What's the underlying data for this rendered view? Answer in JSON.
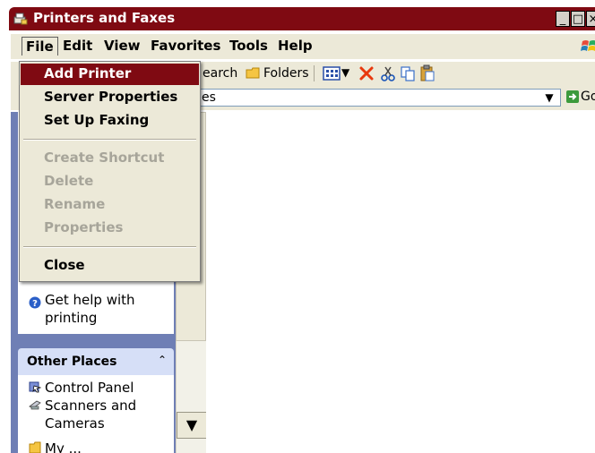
{
  "window": {
    "title": "Printers and Faxes"
  },
  "title_buttons": {
    "minimize": "_",
    "maximize": "□",
    "close": "×"
  },
  "menubar": {
    "items": [
      "File",
      "Edit",
      "View",
      "Favorites",
      "Tools",
      "Help"
    ]
  },
  "toolbar": {
    "search_label_partial": "earch",
    "folders_label": "Folders",
    "view_dropdown_glyph": "▼"
  },
  "address": {
    "value_partial": "es",
    "go_label": "Go"
  },
  "left_pane": {
    "task_links": [
      {
        "label_partial": "printing"
      },
      {
        "label": "Get help with printing"
      }
    ],
    "other_places": {
      "header": "Other Places",
      "collapse_glyph": "»",
      "links": [
        "Control Panel",
        "Scanners and Cameras",
        "My ..."
      ]
    }
  },
  "file_menu": {
    "items": [
      {
        "label": "Add Printer",
        "state": "highlighted"
      },
      {
        "label": "Server Properties",
        "state": "enabled"
      },
      {
        "label": "Set Up Faxing",
        "state": "enabled"
      },
      {
        "separator": true
      },
      {
        "label": "Create Shortcut",
        "state": "disabled"
      },
      {
        "label": "Delete",
        "state": "disabled"
      },
      {
        "label": "Rename",
        "state": "disabled"
      },
      {
        "label": "Properties",
        "state": "disabled"
      },
      {
        "separator": true
      },
      {
        "label": "Close",
        "state": "enabled"
      }
    ]
  },
  "scrollbar": {
    "down_glyph": "▼"
  },
  "colors": {
    "titlebar": "#7f0a12",
    "highlight": "#7f0a12",
    "menu_bg": "#ece9d8",
    "disabled_text": "#a7a59a",
    "left_pane_bg": "#6f7fb5"
  }
}
